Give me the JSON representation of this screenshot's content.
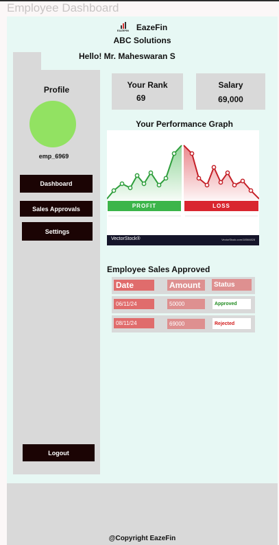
{
  "window": {
    "title": "Employee Dashboard"
  },
  "header": {
    "brand": "EazeFin",
    "logo_text": "EAZEFIN",
    "company": "ABC Solutions",
    "greeting": "Hello! Mr. Maheswaran S"
  },
  "sidebar": {
    "profile_title": "Profile",
    "employee_id": "emp_6969",
    "nav": {
      "dashboard": "Dashboard",
      "sales_approvals": "Sales Approvals",
      "settings": "Settings"
    },
    "logout": "Logout"
  },
  "stats": {
    "rank": {
      "label": "Your Rank",
      "value": "69"
    },
    "salary": {
      "label": "Salary",
      "value": "69,000"
    }
  },
  "performance": {
    "title": "Your Performance Graph",
    "profit_label": "PROFIT",
    "loss_label": "LOSS",
    "credit_left": "VectorStock®",
    "credit_right": "VectorStock.com/18564828",
    "colors": {
      "profit": "#3cb54a",
      "loss": "#d9262f"
    }
  },
  "sales": {
    "title": "Employee Sales Approved",
    "headers": {
      "date": "Date",
      "amount": "Amount",
      "status": "Status"
    },
    "rows": [
      {
        "date": "06/11/24",
        "amount": "50000",
        "status": "Approved",
        "status_color": "#1f8a1f"
      },
      {
        "date": "08/11/24",
        "amount": "69000",
        "status": "Rejected",
        "status_color": "#d11a1a"
      }
    ]
  },
  "footer": {
    "copyright": "@Copyright EazeFin"
  }
}
